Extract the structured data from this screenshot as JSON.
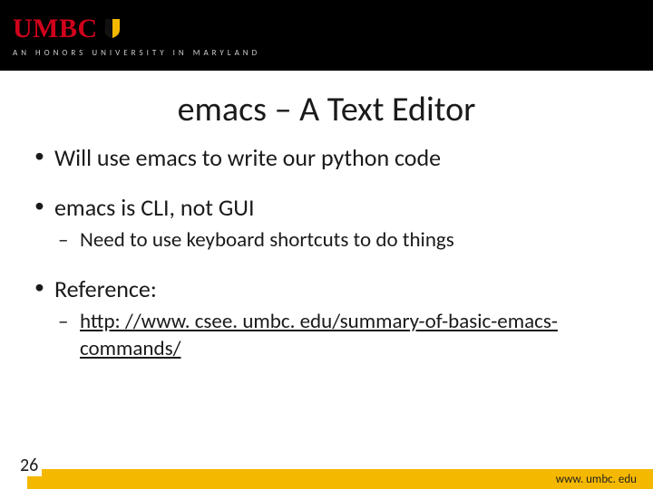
{
  "header": {
    "logo_text": "UMBC",
    "tagline": "AN HONORS UNIVERSITY IN MARYLAND"
  },
  "title": "emacs – A Text Editor",
  "bullets": [
    {
      "text": "Will use emacs to write our python code",
      "sub": []
    },
    {
      "text": "emacs is CLI, not GUI",
      "sub": [
        {
          "text": "Need to use keyboard shortcuts to do things"
        }
      ]
    },
    {
      "text": "Reference:",
      "sub": [
        {
          "text": "http: //www. csee. umbc. edu/summary-of-basic-emacs-commands/",
          "link": true
        }
      ]
    }
  ],
  "footer": {
    "page": "26",
    "site": "www. umbc. edu"
  }
}
